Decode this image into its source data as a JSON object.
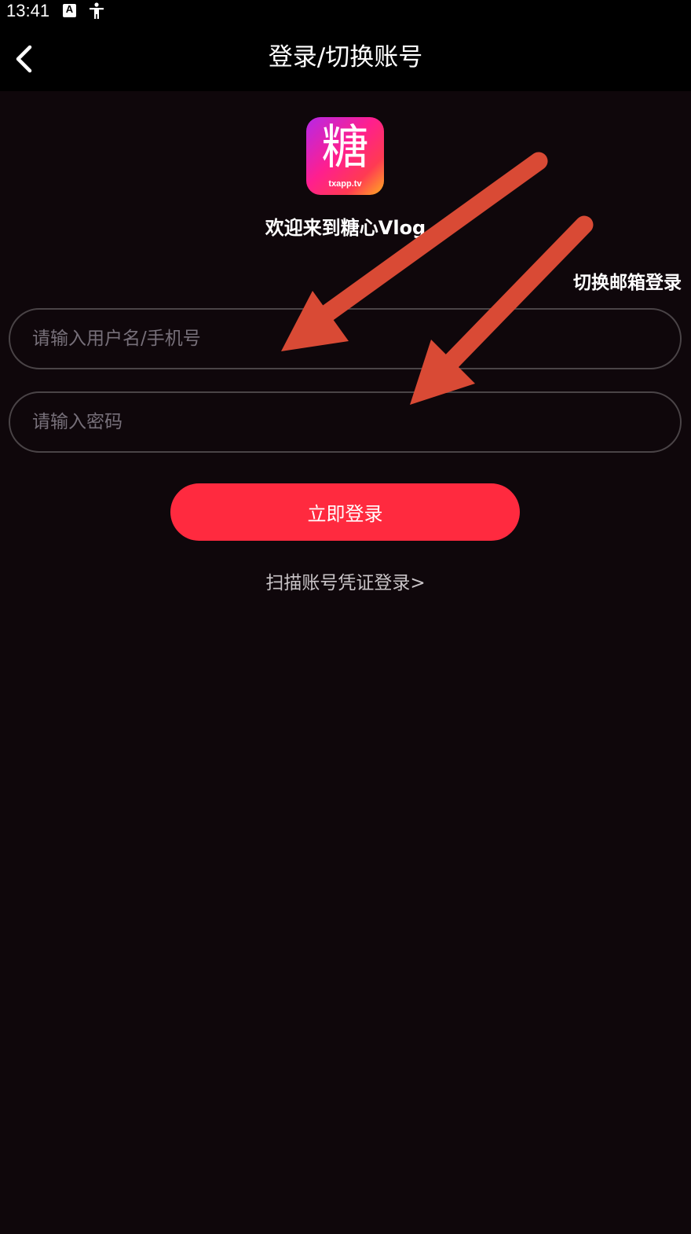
{
  "status_bar": {
    "time": "13:41",
    "icons": [
      "font-a-icon",
      "accessibility-icon"
    ],
    "font_icon_letter": "A"
  },
  "header": {
    "title": "登录/切换账号",
    "back_icon": "chevron-left-icon"
  },
  "logo": {
    "glyph": "糖",
    "domain": "txapp.tv"
  },
  "welcome": "欢迎来到糖心Vlog",
  "switch_email_label": "切换邮箱登录",
  "form": {
    "username_placeholder": "请输入用户名/手机号",
    "username_value": "",
    "password_placeholder": "请输入密码",
    "password_value": ""
  },
  "login_button_label": "立即登录",
  "scan_login_label": "扫描账号凭证登录>",
  "colors": {
    "background": "#0f070b",
    "header": "#000000",
    "accent": "#ff2a3f",
    "annotation_arrow": "#d94a35"
  }
}
